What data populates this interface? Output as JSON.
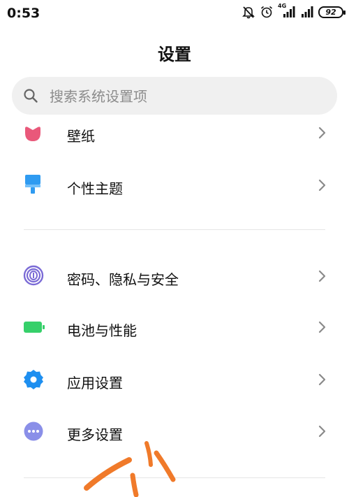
{
  "status_bar": {
    "time": "0:53",
    "network_label": "4G",
    "battery_level": "92",
    "icons": [
      "notifications-muted-icon",
      "alarm-icon",
      "signal-icon",
      "signal-icon",
      "battery-icon"
    ]
  },
  "header": {
    "title": "设置"
  },
  "search": {
    "placeholder": "搜索系统设置项"
  },
  "settings": {
    "items": [
      {
        "label": "壁纸",
        "icon": "wallpaper-icon",
        "color": "#e9587a"
      },
      {
        "label": "个性主题",
        "icon": "theme-brush-icon",
        "color": "#2f9bf1"
      },
      {
        "label": "密码、隐私与安全",
        "icon": "fingerprint-icon",
        "color": "#7b6bd6"
      },
      {
        "label": "电池与性能",
        "icon": "battery-performance-icon",
        "color": "#36d06a"
      },
      {
        "label": "应用设置",
        "icon": "app-settings-gear-icon",
        "color": "#1e8ff0"
      },
      {
        "label": "更多设置",
        "icon": "more-settings-icon",
        "color": "#8a8fe8"
      }
    ]
  },
  "colors": {
    "annotation_stroke": "#f07a2a",
    "search_bg": "#f0f0f0",
    "chevron": "#8a8a8a"
  }
}
